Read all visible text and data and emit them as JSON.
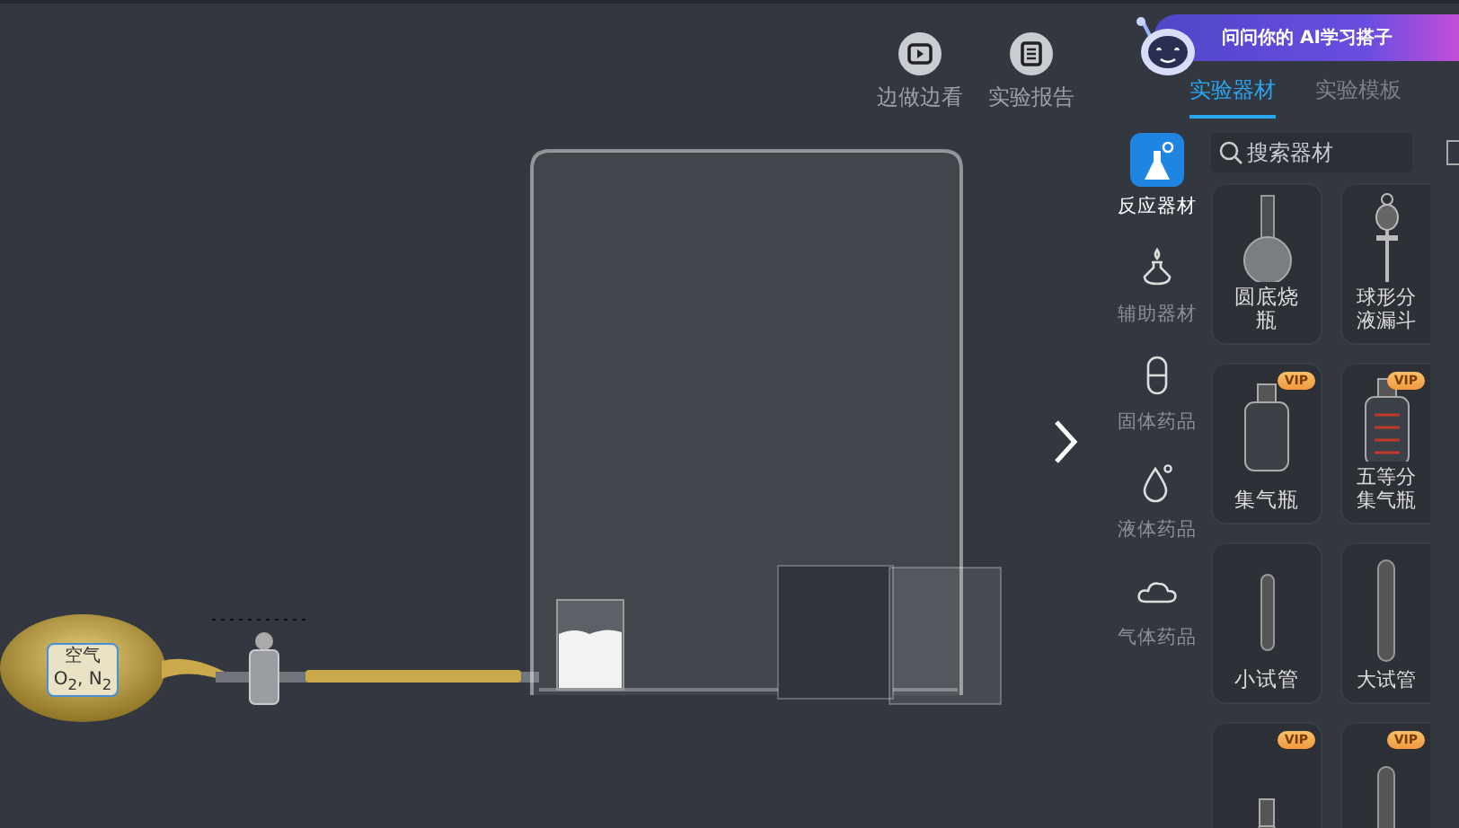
{
  "toolbar": [
    {
      "kind": "video",
      "label": "边做边看"
    },
    {
      "kind": "report",
      "label": "实验报告"
    }
  ],
  "apparatus": {
    "bag_label": {
      "name": "空气",
      "formula": "O$_{2}$, N$_{2}$"
    }
  },
  "assistant_banner": {
    "text": "问问你的 AI学习搭子"
  },
  "tabs": [
    {
      "label": "实验器材",
      "selected": true
    },
    {
      "label": "实验模板",
      "selected": false
    }
  ],
  "categories": [
    {
      "kind": "reaction",
      "label": "反应器材",
      "selected": true
    },
    {
      "kind": "auxiliary",
      "label": "辅助器材",
      "selected": false
    },
    {
      "kind": "solid",
      "label": "固体药品",
      "selected": false
    },
    {
      "kind": "liquid",
      "label": "液体药品",
      "selected": false
    },
    {
      "kind": "gas",
      "label": "气体药品",
      "selected": false
    }
  ],
  "search": {
    "placeholder": "搜索器材"
  },
  "items": [
    {
      "kind": "round-flask",
      "name": "圆底烧瓶"
    },
    {
      "kind": "funnel",
      "name": "球形分液漏斗"
    },
    {
      "kind": "gas-bottle",
      "name": "集气瓶",
      "badge": "VIP"
    },
    {
      "kind": "marked-bottle",
      "name": "五等分集气瓶",
      "badge": "VIP"
    },
    {
      "kind": "small-tube",
      "name": "小试管"
    },
    {
      "kind": "large-tube",
      "name": "大试管"
    },
    {
      "kind": "flask",
      "badge": "VIP"
    },
    {
      "kind": "large-tube",
      "badge": "VIP"
    }
  ]
}
